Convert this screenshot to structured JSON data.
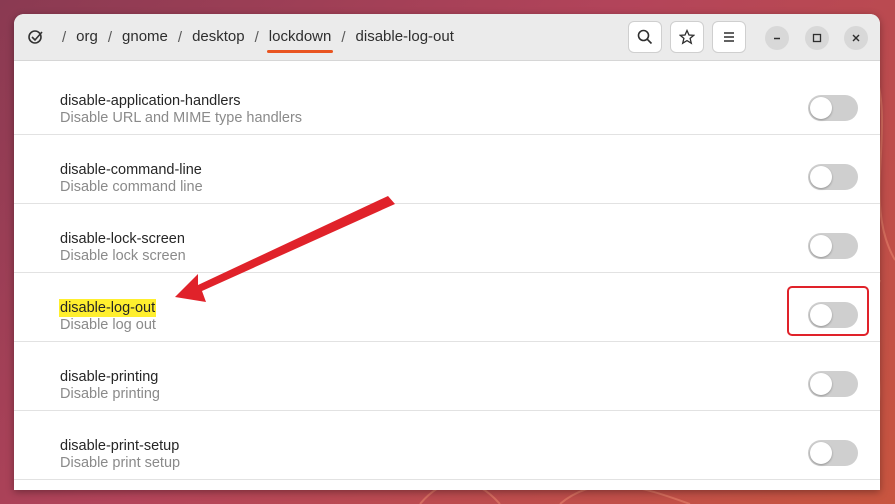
{
  "window": {
    "breadcrumbs": [
      "org",
      "gnome",
      "desktop",
      "lockdown",
      "disable-log-out"
    ],
    "separator": "/",
    "active_crumb_index": 3,
    "accent_color": "#e95420"
  },
  "header_buttons": {
    "search_icon": "search-icon",
    "bookmark_icon": "star-icon",
    "menu_icon": "hamburger-menu-icon",
    "minimize_icon": "minimize-icon",
    "maximize_icon": "maximize-icon",
    "close_icon": "close-icon"
  },
  "settings": [
    {
      "key": "disable-application-handlers",
      "description": "Disable URL and MIME type handlers",
      "enabled": false
    },
    {
      "key": "disable-command-line",
      "description": "Disable command line",
      "enabled": false
    },
    {
      "key": "disable-lock-screen",
      "description": "Disable lock screen",
      "enabled": false
    },
    {
      "key": "disable-log-out",
      "description": "Disable log out",
      "enabled": false,
      "highlighted": true
    },
    {
      "key": "disable-printing",
      "description": "Disable printing",
      "enabled": false
    },
    {
      "key": "disable-print-setup",
      "description": "Disable print setup",
      "enabled": false
    }
  ],
  "annotation": {
    "arrow_color": "#e0222a",
    "highlight_color": "#ffef2e"
  }
}
